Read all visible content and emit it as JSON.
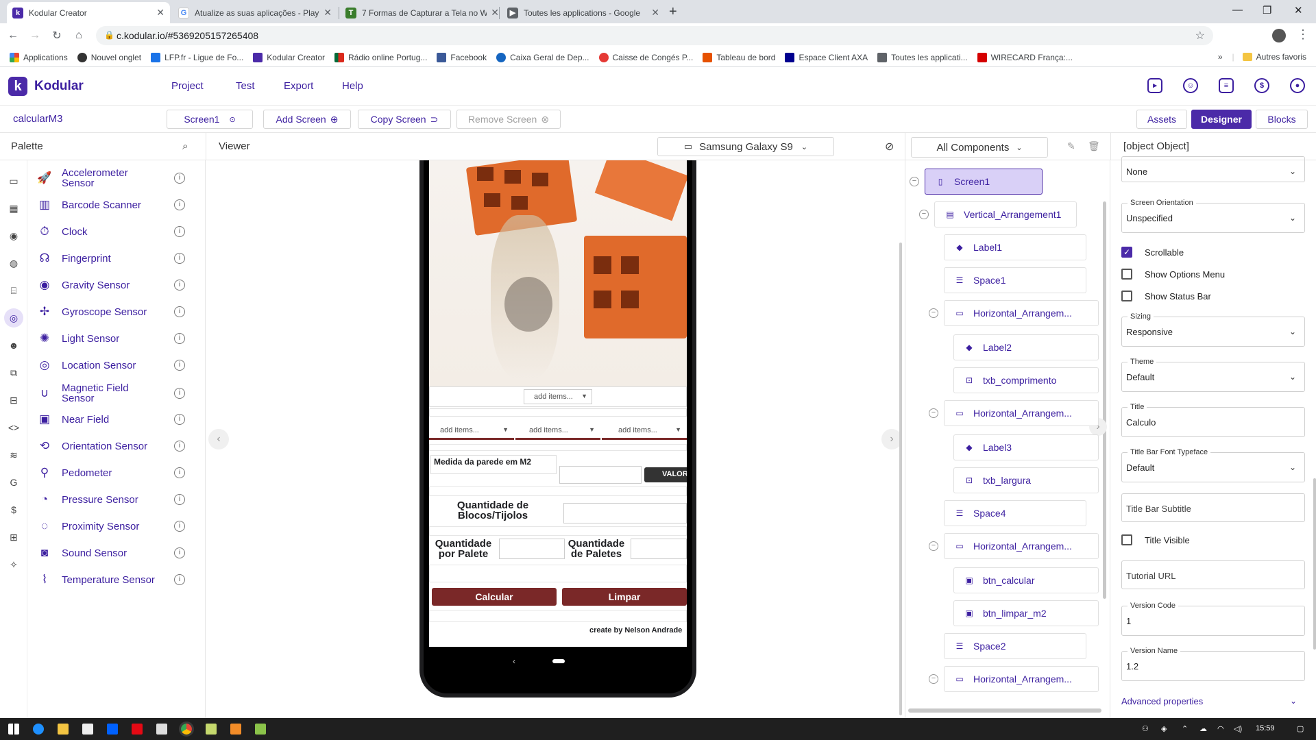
{
  "browser": {
    "tabs": [
      {
        "title": "Kodular Creator",
        "icon": "kodular-icon",
        "color": "#4b2aa8",
        "active": true
      },
      {
        "title": "Atualize as suas aplicações - Play",
        "icon": "google-icon",
        "color": "#4285f4",
        "active": false
      },
      {
        "title": "7 Formas de Capturar a Tela no W",
        "icon": "tecmundo-icon",
        "color": "#3a7d2c",
        "active": false
      },
      {
        "title": "Toutes les applications - Google",
        "icon": "play-console-icon",
        "color": "#5f6368",
        "active": false
      }
    ],
    "new_tab": "+",
    "url": "c.kodular.io/#5369205157265408",
    "bookmarks": [
      {
        "label": "Applications",
        "color": "#e53935"
      },
      {
        "label": "Nouvel onglet",
        "color": "#555555"
      },
      {
        "label": "LFP.fr - Ligue de Fo...",
        "color": "#1a73e8"
      },
      {
        "label": "Kodular Creator",
        "color": "#4b2aa8"
      },
      {
        "label": "Rádio online Portug...",
        "color": "#d32f2f"
      },
      {
        "label": "Facebook",
        "color": "#3b5998"
      },
      {
        "label": "Caixa Geral de Dep...",
        "color": "#1565c0"
      },
      {
        "label": "Caisse de Congés P...",
        "color": "#e53935"
      },
      {
        "label": "Tableau de bord",
        "color": "#e65100"
      },
      {
        "label": "Espace Client AXA",
        "color": "#00008f"
      },
      {
        "label": "Toutes les applicati...",
        "color": "#5f6368"
      },
      {
        "label": "WIRECARD França:...",
        "color": "#d50000"
      }
    ],
    "more_bookmarks": "»",
    "other_bookmarks": "Autres favoris"
  },
  "app": {
    "name": "Kodular",
    "menu": [
      "Project",
      "Test",
      "Export",
      "Help"
    ],
    "header_icons": [
      "folder-icon",
      "gallery-icon",
      "notes-icon",
      "dollar-icon",
      "account-icon"
    ]
  },
  "project": {
    "name": "calcularM3",
    "screen": "Screen1",
    "add_screen": "Add Screen",
    "copy_screen": "Copy Screen",
    "remove_screen": "Remove Screen",
    "assets": "Assets",
    "designer": "Designer",
    "blocks": "Blocks"
  },
  "palette": {
    "title": "Palette",
    "items": [
      {
        "label": "Accelerometer Sensor",
        "icon": "rocket-icon",
        "glyph": "🚀"
      },
      {
        "label": "Barcode Scanner",
        "icon": "barcode-icon",
        "glyph": "▥"
      },
      {
        "label": "Clock",
        "icon": "clock-icon",
        "glyph": "⏱"
      },
      {
        "label": "Fingerprint",
        "icon": "fingerprint-icon",
        "glyph": "☊"
      },
      {
        "label": "Gravity Sensor",
        "icon": "globe-icon",
        "glyph": "◉"
      },
      {
        "label": "Gyroscope Sensor",
        "icon": "gyroscope-icon",
        "glyph": "✢"
      },
      {
        "label": "Light Sensor",
        "icon": "bulb-icon",
        "glyph": "✺"
      },
      {
        "label": "Location Sensor",
        "icon": "location-icon",
        "glyph": "◎"
      },
      {
        "label": "Magnetic Field Sensor",
        "icon": "magnet-icon",
        "glyph": "∪"
      },
      {
        "label": "Near Field",
        "icon": "nfc-icon",
        "glyph": "▣"
      },
      {
        "label": "Orientation Sensor",
        "icon": "orientation-icon",
        "glyph": "⟲"
      },
      {
        "label": "Pedometer",
        "icon": "walk-icon",
        "glyph": "⚲"
      },
      {
        "label": "Pressure Sensor",
        "icon": "gauge-icon",
        "glyph": "◔"
      },
      {
        "label": "Proximity Sensor",
        "icon": "proximity-icon",
        "glyph": "◌"
      },
      {
        "label": "Sound Sensor",
        "icon": "sound-icon",
        "glyph": "◙"
      },
      {
        "label": "Temperature Sensor",
        "icon": "thermometer-icon",
        "glyph": "⌇"
      }
    ],
    "rail": [
      "designer-icon",
      "layout-icon",
      "media-icon",
      "palette-icon",
      "maps-icon",
      "sensors-icon",
      "social-icon",
      "storage-icon",
      "connectivity-icon",
      "code-icon",
      "rss-icon",
      "google-icon",
      "monetization-icon",
      "extensions-icon",
      "puzzle-icon"
    ]
  },
  "viewer": {
    "title": "Viewer",
    "device": "Samsung Galaxy S9",
    "phone": {
      "spinner1": "add items...",
      "spinner2": "add items...",
      "spinner3": "add items...",
      "spinner4": "add items...",
      "label_area": "Medida da parede em M2",
      "valor_btn": "VALOR",
      "label_blocos": "Quantidade de Blocos/Tijolos",
      "label_palete": "Quantidade por Palete",
      "label_paletes": "Quantidade de Paletes",
      "btn_calcular": "Calcular",
      "btn_limpar": "Limpar",
      "footer": "create by Nelson Andrade"
    }
  },
  "components": {
    "title": "All Components",
    "nodes": [
      {
        "label": "Screen1",
        "icon": "phone-icon",
        "glyph": "▯"
      },
      {
        "label": "Vertical_Arrangement1",
        "icon": "vertical-arrangement-icon",
        "glyph": "▤"
      },
      {
        "label": "Label1",
        "icon": "label-icon",
        "glyph": "◆"
      },
      {
        "label": "Space1",
        "icon": "space-icon",
        "glyph": "☰"
      },
      {
        "label": "Horizontal_Arrangem...",
        "icon": "horizontal-arrangement-icon",
        "glyph": "▭"
      },
      {
        "label": "Label2",
        "icon": "label-icon",
        "glyph": "◆"
      },
      {
        "label": "txb_comprimento",
        "icon": "textbox-icon",
        "glyph": "⊡"
      },
      {
        "label": "Horizontal_Arrangem...",
        "icon": "horizontal-arrangement-icon",
        "glyph": "▭"
      },
      {
        "label": "Label3",
        "icon": "label-icon",
        "glyph": "◆"
      },
      {
        "label": "txb_largura",
        "icon": "textbox-icon",
        "glyph": "⊡"
      },
      {
        "label": "Space4",
        "icon": "space-icon",
        "glyph": "☰"
      },
      {
        "label": "Horizontal_Arrangem...",
        "icon": "horizontal-arrangement-icon",
        "glyph": "▭"
      },
      {
        "label": "btn_calcular",
        "icon": "button-icon",
        "glyph": "▣"
      },
      {
        "label": "btn_limpar_m2",
        "icon": "button-icon",
        "glyph": "▣"
      },
      {
        "label": "Space2",
        "icon": "space-icon",
        "glyph": "☰"
      },
      {
        "label": "Horizontal_Arrangem...",
        "icon": "horizontal-arrangement-icon",
        "glyph": "▭"
      }
    ]
  },
  "properties": {
    "title": {
      "label": "Title",
      "value": "Calculo"
    },
    "top_select": "None",
    "screen_orientation": {
      "label": "Screen Orientation",
      "value": "Unspecified"
    },
    "scrollable": {
      "label": "Scrollable",
      "checked": true
    },
    "show_options_menu": {
      "label": "Show Options Menu",
      "checked": false
    },
    "show_status_bar": {
      "label": "Show Status Bar",
      "checked": false
    },
    "sizing": {
      "label": "Sizing",
      "value": "Responsive"
    },
    "theme": {
      "label": "Theme",
      "value": "Default"
    },
    "title_font": {
      "label": "Title Bar Font Typeface",
      "value": "Default"
    },
    "title_subtitle": {
      "placeholder": "Title Bar Subtitle"
    },
    "title_visible": {
      "label": "Title Visible",
      "checked": false
    },
    "tutorial_url": {
      "placeholder": "Tutorial URL"
    },
    "version_code": {
      "label": "Version Code",
      "value": "1"
    },
    "version_name": {
      "label": "Version Name",
      "value": "1.2"
    },
    "advanced": "Advanced properties"
  },
  "taskbar": {
    "time": "15:59"
  }
}
